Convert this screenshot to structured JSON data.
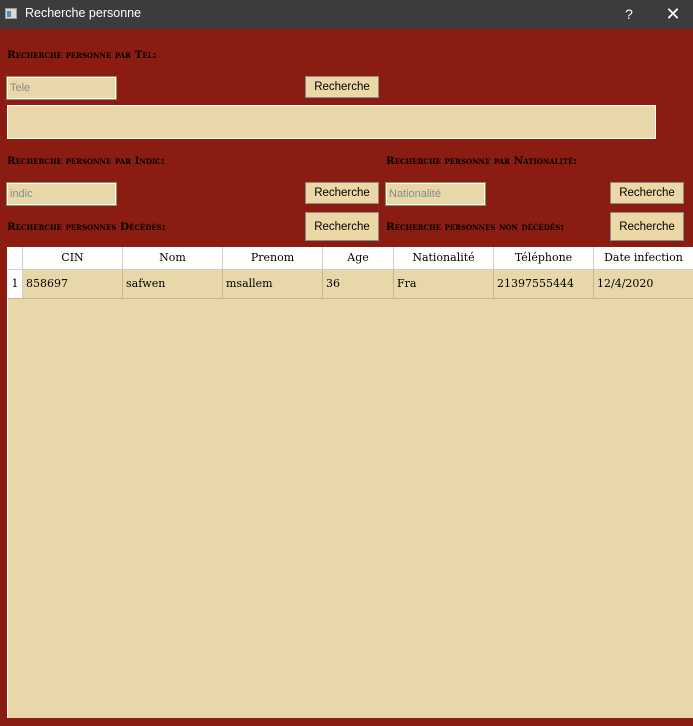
{
  "window": {
    "title": "Recherche personne",
    "help_label": "?",
    "close_label": "✕"
  },
  "tel_section": {
    "label": "Recherche personne par Tel:",
    "input_placeholder": "Tele",
    "input_value": "",
    "button_label": "Recherche"
  },
  "indic_section": {
    "label": "Recherche personne par Indic:",
    "input_placeholder": "indic",
    "input_value": "",
    "button_label": "Recherche"
  },
  "nationalite_section": {
    "label": "Recherche personne par Nationalité:",
    "input_placeholder": "Nationalité",
    "input_value": "",
    "button_label": "Recherche"
  },
  "decedes_section": {
    "label": "Recherche personnes Décédés:",
    "button_label": "Recherche"
  },
  "non_decedes_section": {
    "label": "Recherche personnes non décédés:",
    "button_label": "Recherche"
  },
  "table": {
    "columns": [
      "CIN",
      "Nom",
      "Prenom",
      "Age",
      "Nationalité",
      "Téléphone",
      "Date infection"
    ],
    "rows": [
      {
        "index": "1",
        "cells": [
          "858697",
          "safwen",
          "msallem",
          "36",
          "Fra",
          "21397555444",
          "12/4/2020"
        ]
      }
    ]
  },
  "colors": {
    "background": "#8b1c12",
    "field": "#e8d7a9",
    "titlebar": "#3c3c3c"
  }
}
